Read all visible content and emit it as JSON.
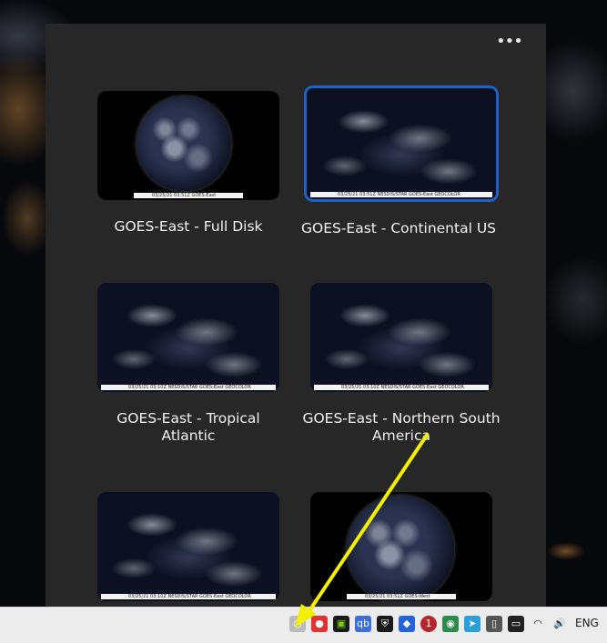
{
  "panel": {
    "more_label": "•••",
    "tiles": [
      {
        "label": "GOES-East - Full Disk",
        "caption": "03/25/21 03:51Z GOES-East"
      },
      {
        "label": "GOES-East - Continental US",
        "caption": "03/25/21 03:51Z NESDIS/STAR GOES-East GEOCOLOR",
        "selected": true
      },
      {
        "label_line1": "GOES-East - Tropical",
        "label_line2": "Atlantic",
        "caption": "03/25/21 03:10Z NESDIS/STAR GOES-East GEOCOLOR"
      },
      {
        "label_line1": "GOES-East - Northern South",
        "label_line2": "America",
        "caption": "03/25/21 03:10Z NESDIS/STAR GOES-East GEOCOLOR"
      },
      {
        "caption": "03/25/21 03:10Z NESDIS/STAR GOES-East GEOCOLOR"
      },
      {
        "caption": "03/25/21 03:51Z GOES-West"
      }
    ]
  },
  "taskbar": {
    "tray_icons": [
      {
        "name": "weather-app-icon",
        "glyph": "◔"
      },
      {
        "name": "chrome-icon",
        "glyph": "●"
      },
      {
        "name": "nvidia-icon",
        "glyph": "▣"
      },
      {
        "name": "qbittorrent-icon",
        "glyph": "qb"
      },
      {
        "name": "defender-shield-icon",
        "glyph": "⛨"
      },
      {
        "name": "dropbox-icon",
        "glyph": "◆"
      },
      {
        "name": "notification-badge-icon",
        "glyph": "1"
      },
      {
        "name": "edge-icon",
        "glyph": "◉"
      },
      {
        "name": "telegram-icon",
        "glyph": "➤"
      },
      {
        "name": "usb-icon",
        "glyph": "▯"
      },
      {
        "name": "battery-icon",
        "glyph": "▭"
      },
      {
        "name": "wifi-icon",
        "glyph": "◠"
      },
      {
        "name": "volume-icon",
        "glyph": "🔊"
      }
    ],
    "language": "ENG"
  },
  "colors": {
    "panel_bg": "#272727",
    "selection_border": "#1c63c9",
    "annotation_arrow": "#f5f000"
  }
}
